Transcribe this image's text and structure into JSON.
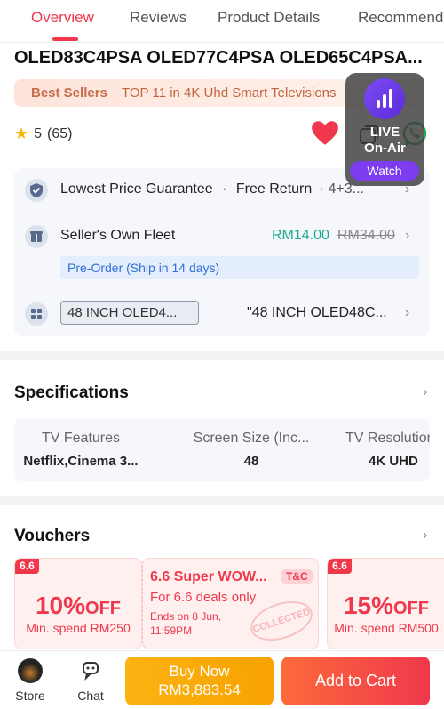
{
  "tabs": [
    {
      "label": "Overview"
    },
    {
      "label": "Reviews"
    },
    {
      "label": "Product Details"
    },
    {
      "label": "Recommendations"
    }
  ],
  "product": {
    "title": "OLED83C4PSA OLED77C4PSA OLED65C4PSA...",
    "best_label": "Best Sellers",
    "best_text": "TOP 11 in 4K Uhd Smart Televisions",
    "rating": "5",
    "review_count": "(65)"
  },
  "live": {
    "line1": "LIVE",
    "line2": "On-Air",
    "watch": "Watch"
  },
  "info": {
    "guarantee": "Lowest Price Guarantee",
    "dot": "·",
    "free_return": "Free Return",
    "more": "· 4+3...",
    "fleet": "Seller's Own Fleet",
    "ship_price": "RM14.00",
    "ship_old": "RM34.00",
    "preorder": "Pre-Order (Ship in 14 days)",
    "variant_box": "48 INCH OLED4...",
    "variant_text": "\"48 INCH OLED48C..."
  },
  "specs": {
    "heading": "Specifications",
    "items": [
      {
        "label": "TV Features",
        "value": "Netflix,Cinema 3..."
      },
      {
        "label": "Screen Size (Inc...",
        "value": "48"
      },
      {
        "label": "TV Resolution",
        "value": "4K UHD"
      }
    ]
  },
  "vouchers": {
    "heading": "Vouchers",
    "tag": "6.6",
    "v1": {
      "amount": "10%",
      "unit": "OFF",
      "min": "Min. spend RM250"
    },
    "v2": {
      "title": "6.6 Super WOW...",
      "tc": "T&C",
      "sub": "For 6.6 deals only",
      "ends1": "Ends on 8 Jun,",
      "ends2": "11:59PM",
      "stamp": "COLLECTED"
    },
    "v3": {
      "amount": "15%",
      "unit": "OFF",
      "min": "Min. spend RM500"
    }
  },
  "bottom": {
    "store": "Store",
    "chat": "Chat",
    "buy_label": "Buy Now",
    "buy_price": "RM3,883.54",
    "cart": "Add to Cart"
  },
  "colors": {
    "accent": "#f0384d",
    "buy": "#f8a200",
    "live": "#7d3cf0",
    "price": "#1aaa8b"
  }
}
